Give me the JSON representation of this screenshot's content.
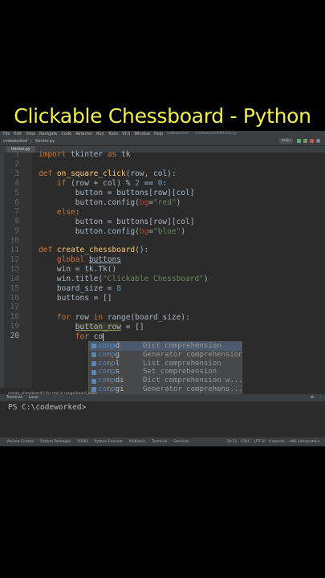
{
  "title": "Clickable Chessboard - Python",
  "ide": {
    "menu": [
      "File",
      "Edit",
      "View",
      "Navigate",
      "Code",
      "Refactor",
      "Run",
      "Tools",
      "VCS",
      "Window",
      "Help"
    ],
    "window_title": "codeworked - ...\\codeworked\\tkinter.py",
    "nav": {
      "project": "codeworked",
      "file": "tkinter.py"
    },
    "run_config": "main",
    "tab": "tkinter.py",
    "lines": [
      "1",
      "2",
      "3",
      "4",
      "5",
      "6",
      "7",
      "8",
      "9",
      "10",
      "11",
      "12",
      "13",
      "14",
      "15",
      "16",
      "17",
      "18",
      "19",
      "20"
    ],
    "breadcrumb": "create_chessboard()    for row in range(board_size)",
    "terminal": {
      "tab_terminal": "Terminal:",
      "tab_local": "Local",
      "prompt": "PS C:\\codeworked>"
    },
    "statusbar": {
      "items": [
        "Version Control",
        "Python Packages",
        "TODO",
        "Python Console",
        "Problems",
        "Terminal",
        "Services"
      ],
      "right": [
        "20:11",
        "CRLF",
        "UTF-8",
        "4 spaces",
        "<No interpreter>"
      ]
    }
  },
  "completion": {
    "items": [
      {
        "name": "compd",
        "match": "comp",
        "rest": "d",
        "desc": "Dict comprehension"
      },
      {
        "name": "compg",
        "match": "comp",
        "rest": "g",
        "desc": "Generator comprehension"
      },
      {
        "name": "compl",
        "match": "comp",
        "rest": "l",
        "desc": "List comprehension"
      },
      {
        "name": "comps",
        "match": "comp",
        "rest": "s",
        "desc": "Set comprehension"
      },
      {
        "name": "compdi",
        "match": "comp",
        "rest": "di",
        "desc": "Dict comprehension w..."
      },
      {
        "name": "compgi",
        "match": "comp",
        "rest": "gi",
        "desc": "Generator comprehens..."
      },
      {
        "name": "compli",
        "match": "comp",
        "rest": "li",
        "desc": "List comprehension w..."
      },
      {
        "name": "compsi",
        "match": "comp",
        "rest": "si",
        "desc": "Set comprehension wi..."
      }
    ],
    "hint": "Press Enter to insert, Tab to replace. Next Tip"
  }
}
